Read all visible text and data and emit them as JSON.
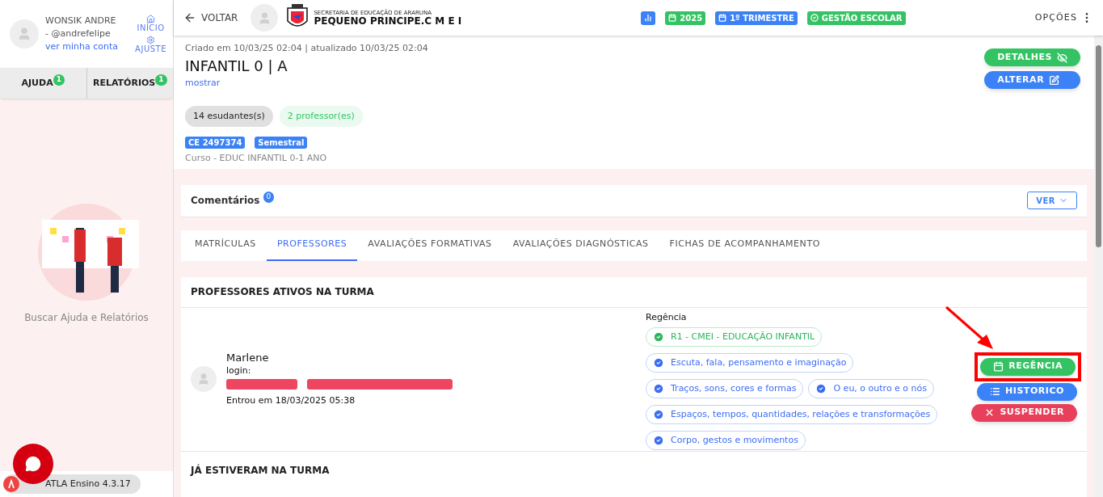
{
  "sidebar": {
    "user": {
      "name": "WONSIK ANDRE - @andrefelipe",
      "account_link": "ver minha conta"
    },
    "nav": [
      {
        "label": "INÍCIO",
        "kind": "home"
      },
      {
        "label": "AJUSTE",
        "kind": "settings"
      }
    ],
    "tabs": [
      {
        "label": "AJUDA",
        "count": "1",
        "selected": false
      },
      {
        "label": "RELATÓRIOS",
        "count": "1",
        "selected": false
      }
    ],
    "help_caption": "Buscar Ajuda e Relatórios",
    "version": "ATLA Ensino 4.3.17"
  },
  "header": {
    "back": "VOLTAR",
    "org": "SECRETARIA DE EDUCAÇÃO DE ARARUNA",
    "school": "PEQUENO PRINCIPE.C M E I",
    "badges": [
      {
        "kind": "chart",
        "color": "#3b82f6"
      },
      {
        "label": "2025",
        "kind": "calendar",
        "color": "#34c363"
      },
      {
        "label": "1º TRIMESTRE",
        "kind": "calendar",
        "color": "#3b82f6"
      },
      {
        "label": "GESTÃO ESCOLAR",
        "kind": "check",
        "color": "#34c363"
      }
    ],
    "options": "OPÇÕES"
  },
  "class": {
    "meta": "Criado em 10/03/25 02:04 | atualizado 10/03/25 02:04",
    "title": "INFANTIL 0 | A",
    "show_link": "mostrar",
    "actions": [
      {
        "label": "DETALHES",
        "kind": "details"
      },
      {
        "label": "ALTERAR",
        "kind": "edit"
      }
    ],
    "counts": [
      {
        "label": "14 esudantes(s)",
        "kind": "students"
      },
      {
        "label": "2 professor(es)",
        "kind": "teachers"
      }
    ],
    "tags": [
      "CE 2497374",
      "Semestral"
    ],
    "course": "Curso - EDUC INFANTIL 0-1 ANO"
  },
  "comments": {
    "label": "Comentários",
    "count": "0",
    "button": "VER"
  },
  "tabs": [
    {
      "label": "MATRÍCULAS",
      "selected": false
    },
    {
      "label": "PROFESSORES",
      "selected": true
    },
    {
      "label": "AVALIAÇÕES FORMATIVAS",
      "selected": false
    },
    {
      "label": "AVALIAÇÕES DIAGNÓSTICAS",
      "selected": false
    },
    {
      "label": "FICHAS DE ACOMPANHAMENTO",
      "selected": false
    }
  ],
  "active_teachers": {
    "title": "PROFESSORES ATIVOS NA TURMA",
    "teacher": {
      "name": "Marlene",
      "login": "login:",
      "joined": "Entrou em 18/03/2025 05:38"
    },
    "regencia_label": "Regência",
    "regencias": [
      {
        "label": "R1 - CMEI - EDUCAÇÃO INFANTIL",
        "kind": "main"
      },
      {
        "label": "Escuta, fala, pensamento e imaginação",
        "kind": "field"
      },
      {
        "label": "Traços, sons, cores e formas",
        "kind": "field"
      },
      {
        "label": "O eu, o outro e o nós",
        "kind": "field"
      },
      {
        "label": "Espaços, tempos, quantidades, relações e transformações",
        "kind": "field"
      },
      {
        "label": "Corpo, gestos e movimentos",
        "kind": "field"
      }
    ],
    "actions": [
      {
        "label": "REGÊNCIA",
        "kind": "regencia"
      },
      {
        "label": "HISTORICO",
        "kind": "history"
      },
      {
        "label": "SUSPENDER",
        "kind": "suspend"
      }
    ]
  },
  "past_teachers": {
    "title": "JÁ ESTIVERAM NA TURMA"
  }
}
